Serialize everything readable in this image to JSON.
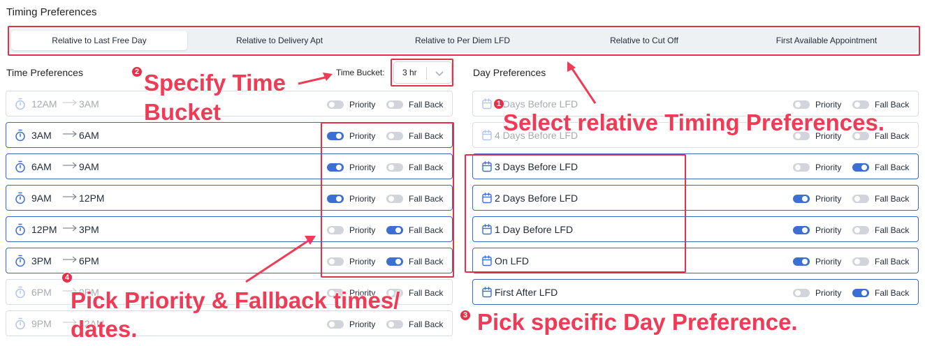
{
  "page": {
    "title": "Timing Preferences"
  },
  "tabs": [
    {
      "label": "Relative to Last Free Day",
      "active": true
    },
    {
      "label": "Relative to Delivery Apt",
      "active": false
    },
    {
      "label": "Relative to Per Diem LFD",
      "active": false
    },
    {
      "label": "Relative to Cut Off",
      "active": false
    },
    {
      "label": "First Available Appointment",
      "active": false
    }
  ],
  "time_prefs": {
    "heading": "Time Preferences",
    "bucket_label": "Time Bucket:",
    "bucket_value": "3 hr",
    "rows": [
      {
        "from": "12AM",
        "to": "3AM",
        "disabled": true,
        "priority": false,
        "fallback": false
      },
      {
        "from": "3AM",
        "to": "6AM",
        "disabled": false,
        "priority": true,
        "fallback": false
      },
      {
        "from": "6AM",
        "to": "9AM",
        "disabled": false,
        "priority": true,
        "fallback": false
      },
      {
        "from": "9AM",
        "to": "12PM",
        "disabled": false,
        "priority": true,
        "fallback": false
      },
      {
        "from": "12PM",
        "to": "3PM",
        "disabled": false,
        "priority": false,
        "fallback": true
      },
      {
        "from": "3PM",
        "to": "6PM",
        "disabled": false,
        "priority": false,
        "fallback": true
      },
      {
        "from": "6PM",
        "to": "9PM",
        "disabled": true,
        "priority": false,
        "fallback": false
      },
      {
        "from": "9PM",
        "to": "12AM",
        "disabled": true,
        "priority": false,
        "fallback": false
      }
    ]
  },
  "day_prefs": {
    "heading": "Day Preferences",
    "rows": [
      {
        "label": "5 Days Before LFD",
        "disabled": true,
        "priority": false,
        "fallback": false
      },
      {
        "label": "4 Days Before LFD",
        "disabled": true,
        "priority": false,
        "fallback": false
      },
      {
        "label": "3 Days Before LFD",
        "disabled": false,
        "priority": false,
        "fallback": true
      },
      {
        "label": "2 Days Before LFD",
        "disabled": false,
        "priority": true,
        "fallback": false
      },
      {
        "label": "1 Day Before LFD",
        "disabled": false,
        "priority": true,
        "fallback": false
      },
      {
        "label": "On LFD",
        "disabled": false,
        "priority": true,
        "fallback": false
      },
      {
        "label": "First After LFD",
        "disabled": false,
        "priority": false,
        "fallback": true
      }
    ]
  },
  "toggle_labels": {
    "priority": "Priority",
    "fallback": "Fall Back"
  },
  "annotations": {
    "a1": {
      "num": "1",
      "text": "Select relative Timing Preferences."
    },
    "a2": {
      "num": "2",
      "line1": "Specify Time",
      "line2": "Bucket"
    },
    "a3": {
      "num": "3",
      "text": "Pick specific Day Preference."
    },
    "a4": {
      "num": "4",
      "line1": "Pick Priority & Fallback times/",
      "line2": "dates."
    }
  },
  "colors": {
    "accent": "#3b6fd4",
    "annotation": "#e5304a",
    "active_border": "#3b69b5"
  },
  "icons": {
    "time_row": "stopwatch-icon",
    "day_row": "calendar-icon",
    "range": "long-arrow-right-icon",
    "bucket": "chevron-down-icon"
  }
}
